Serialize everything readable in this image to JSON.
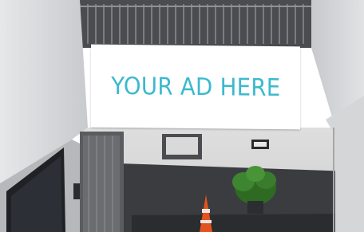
{
  "billboard": {
    "text": "YOUR AD HERE",
    "text_color": "#3bb9cf",
    "panel_color": "#ffffff"
  },
  "scene": {
    "wall_colors": [
      "#cfd0d3",
      "#4e4f53",
      "#25272b"
    ],
    "traffic_cone_color": "#e2531f",
    "plant_color": "#2f6a23"
  }
}
